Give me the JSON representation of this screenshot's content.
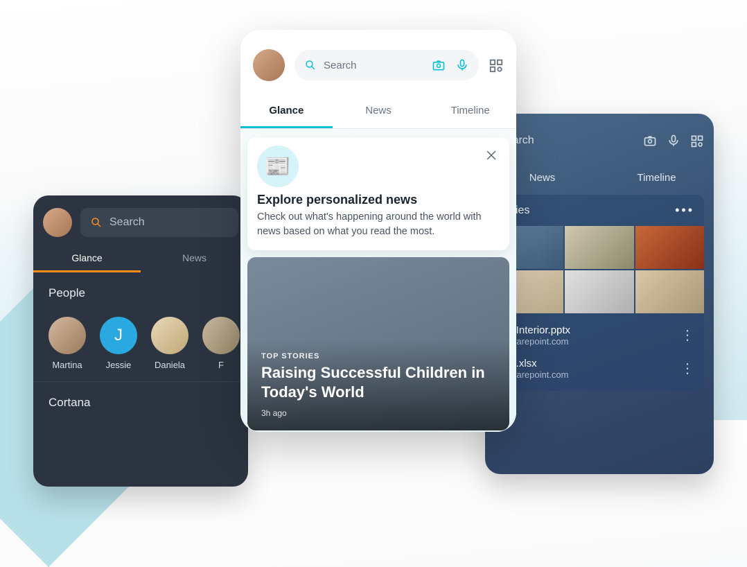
{
  "left_phone": {
    "search_placeholder": "Search",
    "icons": {
      "color": "#ff8c1a"
    },
    "tabs": [
      {
        "label": "Glance",
        "active": true
      },
      {
        "label": "News",
        "active": false
      }
    ],
    "section_people": "People",
    "section_cortana": "Cortana",
    "people": [
      {
        "name": "Martina",
        "avatar_bg": "linear-gradient(135deg,#d4b8a0,#9a7a5a)"
      },
      {
        "name": "Jessie",
        "avatar_bg": "#2aa8e0",
        "initial": "J"
      },
      {
        "name": "Daniela",
        "avatar_bg": "linear-gradient(135deg,#e8d8b8,#c0a878)"
      },
      {
        "name": "F",
        "avatar_bg": "linear-gradient(135deg,#c8b8a0,#9a8a6a)"
      }
    ]
  },
  "center_phone": {
    "search_placeholder": "Search",
    "tabs": [
      {
        "label": "Glance",
        "active": true
      },
      {
        "label": "News",
        "active": false
      },
      {
        "label": "Timeline",
        "active": false
      }
    ],
    "banner": {
      "title": "Explore personalized news",
      "body": "Check out what's happening around the world with news based on what you read the most."
    },
    "story": {
      "label": "TOP STORIES",
      "headline": "Raising Successful Children in Today's World",
      "time": "3h ago"
    },
    "accent_color": "#0dc0d8"
  },
  "right_phone": {
    "search_placeholder": "Search",
    "tabs": [
      {
        "label": "News"
      },
      {
        "label": "Timeline"
      }
    ],
    "activities_title": "vities",
    "thumbnails": [
      "linear-gradient(135deg,#6a8aa8,#3a5a78)",
      "linear-gradient(135deg,#d0c8b0,#8a8a6a)",
      "linear-gradient(135deg,#c86838,#883018)",
      "linear-gradient(135deg,#e8d8c0,#b8a888)",
      "linear-gradient(135deg,#e0e0e0,#b0b0b0)",
      "linear-gradient(135deg,#d8c8a8,#a89878)"
    ],
    "files": [
      {
        "name": "o_Interior.pptx",
        "sub": ".sharepoint.com"
      },
      {
        "name": "ng.xlsx",
        "sub": ".sharepoint.com"
      }
    ]
  }
}
